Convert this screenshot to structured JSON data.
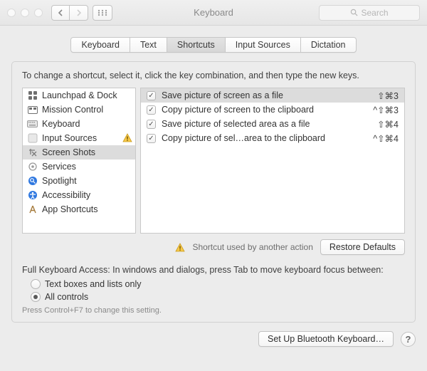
{
  "window": {
    "title": "Keyboard",
    "search_placeholder": "Search"
  },
  "tabs": [
    {
      "label": "Keyboard",
      "selected": false
    },
    {
      "label": "Text",
      "selected": false
    },
    {
      "label": "Shortcuts",
      "selected": true
    },
    {
      "label": "Input Sources",
      "selected": false
    },
    {
      "label": "Dictation",
      "selected": false
    }
  ],
  "instruction": "To change a shortcut, select it, click the key combination, and then type the new keys.",
  "categories": [
    {
      "label": "Launchpad & Dock",
      "icon": "launchpad",
      "selected": false,
      "warning": false
    },
    {
      "label": "Mission Control",
      "icon": "mission-control",
      "selected": false,
      "warning": false
    },
    {
      "label": "Keyboard",
      "icon": "keyboard",
      "selected": false,
      "warning": false
    },
    {
      "label": "Input Sources",
      "icon": "input-sources",
      "selected": false,
      "warning": true
    },
    {
      "label": "Screen Shots",
      "icon": "screenshot",
      "selected": true,
      "warning": false
    },
    {
      "label": "Services",
      "icon": "services",
      "selected": false,
      "warning": false
    },
    {
      "label": "Spotlight",
      "icon": "spotlight",
      "selected": false,
      "warning": false
    },
    {
      "label": "Accessibility",
      "icon": "accessibility",
      "selected": false,
      "warning": false
    },
    {
      "label": "App Shortcuts",
      "icon": "app-shortcuts",
      "selected": false,
      "warning": false
    }
  ],
  "shortcuts": [
    {
      "enabled": true,
      "label": "Save picture of screen as a file",
      "keys": "⇧⌘3",
      "selected": true
    },
    {
      "enabled": true,
      "label": "Copy picture of screen to the clipboard",
      "keys": "^⇧⌘3",
      "selected": false
    },
    {
      "enabled": true,
      "label": "Save picture of selected area as a file",
      "keys": "⇧⌘4",
      "selected": false
    },
    {
      "enabled": true,
      "label": "Copy picture of sel…area to the clipboard",
      "keys": "^⇧⌘4",
      "selected": false
    }
  ],
  "conflict_note": "Shortcut used by another action",
  "restore_button": "Restore Defaults",
  "full_keyboard_access": {
    "label": "Full Keyboard Access: In windows and dialogs, press Tab to move keyboard focus between:",
    "options": [
      {
        "label": "Text boxes and lists only",
        "checked": false
      },
      {
        "label": "All controls",
        "checked": true
      }
    ],
    "hint": "Press Control+F7 to change this setting."
  },
  "footer": {
    "bluetooth_button": "Set Up Bluetooth Keyboard…",
    "help_label": "?"
  },
  "icons": {
    "launchpad": "▦",
    "mission-control": "▭",
    "keyboard": "⌨",
    "input-sources": "🇦",
    "screenshot": "✂",
    "services": "⚙",
    "spotlight": "🔍",
    "accessibility": "♿",
    "app-shortcuts": "A"
  }
}
